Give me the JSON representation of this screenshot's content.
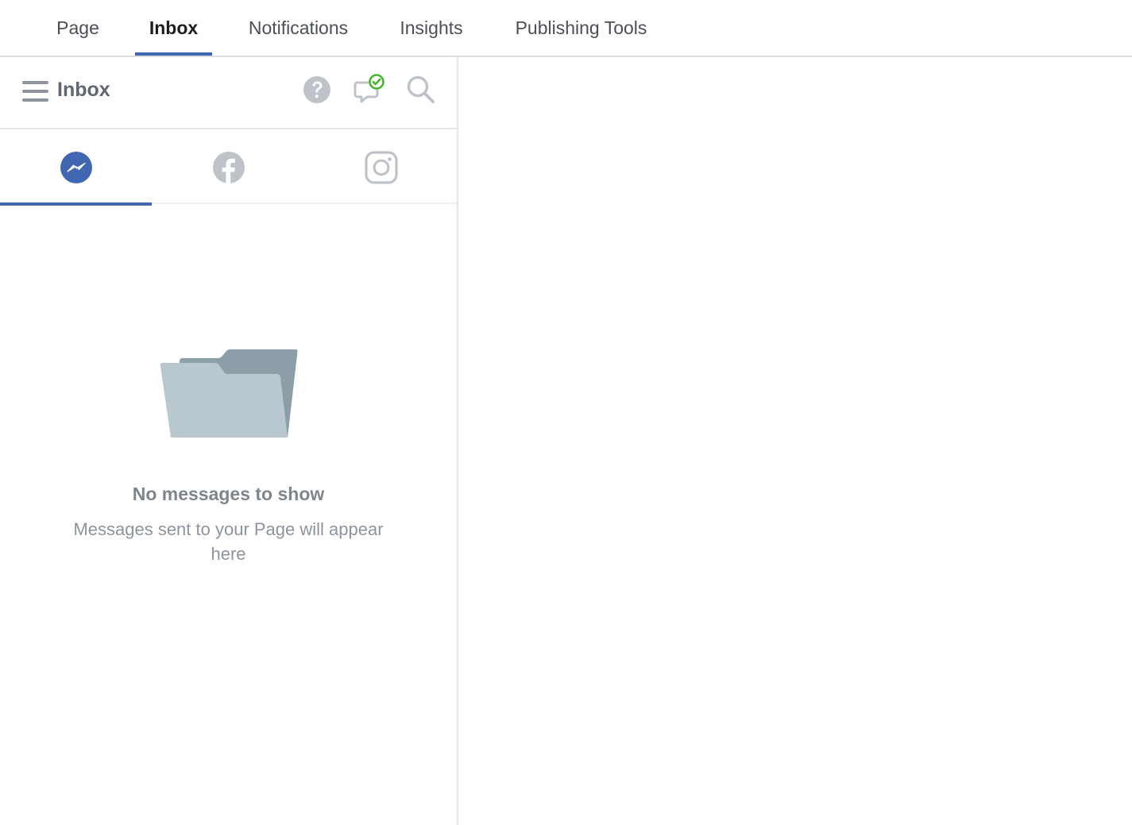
{
  "topnav": {
    "tabs": [
      {
        "label": "Page"
      },
      {
        "label": "Inbox"
      },
      {
        "label": "Notifications"
      },
      {
        "label": "Insights"
      },
      {
        "label": "Publishing Tools"
      }
    ],
    "active_tab": "Inbox"
  },
  "inbox": {
    "title": "Inbox",
    "header_icons": [
      "hamburger-menu-icon",
      "help-icon",
      "comments-check-icon",
      "search-icon"
    ],
    "channels": [
      {
        "name": "messenger-icon",
        "active": true
      },
      {
        "name": "facebook-icon",
        "active": false
      },
      {
        "name": "instagram-icon",
        "active": false
      }
    ],
    "empty_state": {
      "icon": "folder-icon",
      "title": "No messages to show",
      "subtitle": "Messages sent to your Page will appear here"
    }
  },
  "colors": {
    "accent": "#4267b2",
    "icon_gray": "#bec3c9",
    "status_green": "#42b72a",
    "folder_front": "#b9c8ce",
    "folder_back": "#8c9ea7"
  }
}
